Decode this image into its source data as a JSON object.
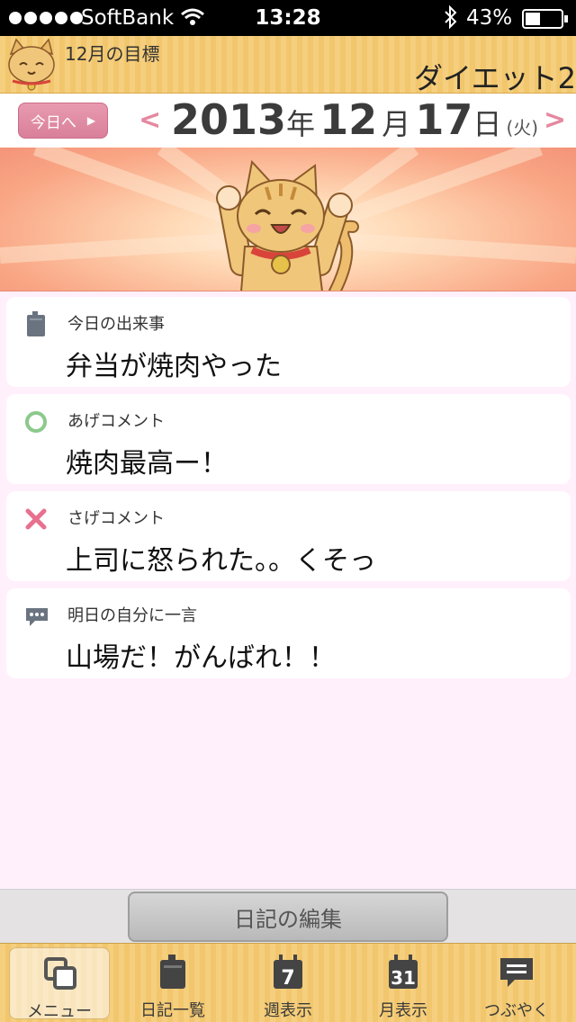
{
  "status_bar": {
    "carrier": "SoftBank",
    "time": "13:28",
    "battery": "43%"
  },
  "goal": {
    "month_label": "12月の目標",
    "text": "ダイエット2"
  },
  "date_bar": {
    "today_button": "今日へ",
    "year": "2013",
    "year_unit": "年",
    "month": "12",
    "month_unit": "月",
    "day": "17",
    "day_unit": "日",
    "weekday": "(火)"
  },
  "entries": [
    {
      "icon": "diary-book-icon",
      "label": "今日の出来事",
      "value": "弁当が焼肉やった"
    },
    {
      "icon": "circle-icon",
      "label": "あげコメント",
      "value": "焼肉最高ー！"
    },
    {
      "icon": "cross-icon",
      "label": "さげコメント",
      "value": "上司に怒られた。。くそっ"
    },
    {
      "icon": "speech-bubble-icon",
      "label": "明日の自分に一言",
      "value": "山場だ！がんばれ！！"
    }
  ],
  "edit_button": "日記の編集",
  "tabs": [
    {
      "label": "メニュー",
      "icon": "menu-windows-icon",
      "active": true
    },
    {
      "label": "日記一覧",
      "icon": "diary-book-icon"
    },
    {
      "label": "週表示",
      "icon": "calendar-week-icon",
      "icon_text": "7"
    },
    {
      "label": "月表示",
      "icon": "calendar-month-icon",
      "icon_text": "31"
    },
    {
      "label": "つぶやく",
      "icon": "speech-bubble-icon"
    }
  ],
  "colors": {
    "header_gold": "#f5cf7e",
    "accent_pink": "#e6889f",
    "background_pink": "#fff0fb",
    "circle_green": "#8cc98c",
    "cross_pink": "#e8708e"
  }
}
